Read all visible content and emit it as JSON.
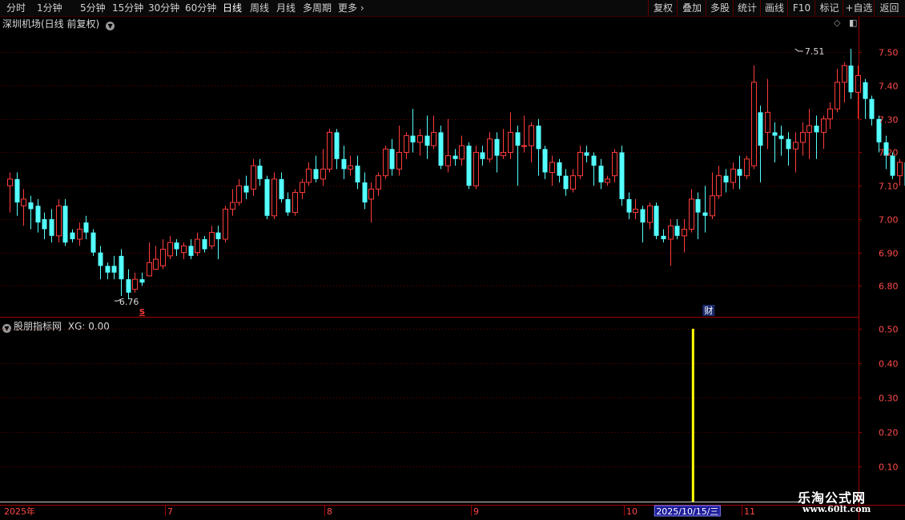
{
  "toolbar": {
    "periods": [
      "分时",
      "1分钟",
      "5分钟",
      "15分钟",
      "30分钟",
      "60分钟",
      "日线",
      "周线",
      "月线",
      "多周期",
      "更多"
    ],
    "active_period": "日线",
    "actions": [
      "复权",
      "叠加",
      "多股",
      "统计",
      "画线",
      "F10",
      "标记",
      "+自选",
      "返回"
    ]
  },
  "main_panel": {
    "title": "深圳机场(日线 前复权)",
    "high_label": "7.51",
    "low_label": "6.76",
    "marker_s": "S",
    "marker_cai": "财"
  },
  "sub_panel": {
    "title": "股朋指标网",
    "xg_label": "XG: 0.00"
  },
  "colors": {
    "up": "#ff3c3c",
    "down": "#54ffff",
    "signal": "#ffff00",
    "axis": "#a00000",
    "grid": "#6a0000"
  },
  "watermark": {
    "line1": "乐淘公式网",
    "line2": "www.60lt.com"
  },
  "chart_data": [
    {
      "type": "candlestick",
      "title": "深圳机场(日线 前复权)",
      "y_axis": {
        "ticks": [
          6.8,
          6.9,
          7.0,
          7.1,
          7.2,
          7.3,
          7.4,
          7.5
        ],
        "tick_labels": [
          "6.80",
          "6.90",
          "7.00",
          "7.10",
          "7.20",
          "7.30",
          "7.40",
          "7.50"
        ],
        "range": [
          6.71,
          7.57
        ]
      },
      "x_axis": {
        "month_labels": [
          "2025年",
          "7",
          "8",
          "9",
          "10",
          "11"
        ],
        "month_start_index": [
          0,
          23,
          46,
          67,
          89,
          106
        ],
        "highlighted_date": "2025/10/15/三",
        "highlighted_index": 99
      },
      "high": {
        "value": 7.51,
        "index": 113
      },
      "low": {
        "value": 6.76,
        "index": 16
      },
      "candles": [
        [
          7.1,
          7.12,
          7.14,
          7.02
        ],
        [
          7.12,
          7.05,
          7.14,
          7.01
        ],
        [
          7.04,
          7.06,
          7.09,
          6.98
        ],
        [
          7.05,
          7.03,
          7.07,
          6.97
        ],
        [
          7.04,
          6.99,
          7.06,
          6.96
        ],
        [
          7.0,
          6.97,
          7.02,
          6.94
        ],
        [
          7.0,
          6.95,
          7.03,
          6.93
        ],
        [
          6.95,
          7.04,
          7.06,
          6.93
        ],
        [
          7.04,
          6.93,
          7.06,
          6.92
        ],
        [
          6.96,
          6.94,
          6.97,
          6.93
        ],
        [
          6.94,
          6.97,
          6.99,
          6.92
        ],
        [
          6.99,
          6.96,
          7.01,
          6.94
        ],
        [
          6.96,
          6.9,
          6.97,
          6.89
        ],
        [
          6.9,
          6.86,
          6.92,
          6.82
        ],
        [
          6.86,
          6.84,
          6.87,
          6.82
        ],
        [
          6.86,
          6.84,
          6.89,
          6.82
        ],
        [
          6.89,
          6.82,
          6.91,
          6.77
        ],
        [
          6.82,
          6.78,
          6.85,
          6.76
        ],
        [
          6.79,
          6.82,
          6.84,
          6.78
        ],
        [
          6.82,
          6.81,
          6.84,
          6.8
        ],
        [
          6.83,
          6.87,
          6.93,
          6.83
        ],
        [
          6.85,
          6.88,
          6.92,
          6.85
        ],
        [
          6.86,
          6.91,
          6.94,
          6.85
        ],
        [
          6.89,
          6.93,
          6.95,
          6.88
        ],
        [
          6.93,
          6.91,
          6.94,
          6.89
        ],
        [
          6.9,
          6.92,
          6.93,
          6.88
        ],
        [
          6.92,
          6.89,
          6.94,
          6.88
        ],
        [
          6.9,
          6.94,
          6.96,
          6.89
        ],
        [
          6.94,
          6.91,
          6.95,
          6.9
        ],
        [
          6.92,
          6.96,
          6.98,
          6.91
        ],
        [
          6.96,
          6.94,
          6.98,
          6.88
        ],
        [
          6.94,
          7.03,
          7.04,
          6.93
        ],
        [
          7.03,
          7.05,
          7.09,
          7.01
        ],
        [
          7.05,
          7.1,
          7.12,
          7.04
        ],
        [
          7.1,
          7.08,
          7.13,
          7.06
        ],
        [
          7.09,
          7.16,
          7.18,
          7.07
        ],
        [
          7.16,
          7.12,
          7.18,
          7.1
        ],
        [
          7.12,
          7.01,
          7.13,
          7.0
        ],
        [
          7.01,
          7.12,
          7.14,
          7.0
        ],
        [
          7.12,
          7.06,
          7.14,
          7.05
        ],
        [
          7.06,
          7.02,
          7.08,
          7.01
        ],
        [
          7.02,
          7.08,
          7.09,
          7.01
        ],
        [
          7.08,
          7.11,
          7.12,
          7.06
        ],
        [
          7.11,
          7.15,
          7.17,
          7.1
        ],
        [
          7.15,
          7.12,
          7.19,
          7.11
        ],
        [
          7.12,
          7.15,
          7.21,
          7.1
        ],
        [
          7.15,
          7.26,
          7.27,
          7.14
        ],
        [
          7.26,
          7.18,
          7.27,
          7.15
        ],
        [
          7.18,
          7.15,
          7.22,
          7.12
        ],
        [
          7.15,
          7.16,
          7.19,
          7.13
        ],
        [
          7.16,
          7.11,
          7.19,
          7.09
        ],
        [
          7.11,
          7.05,
          7.14,
          7.03
        ],
        [
          7.06,
          7.09,
          7.11,
          6.99
        ],
        [
          7.09,
          7.13,
          7.14,
          7.07
        ],
        [
          7.13,
          7.21,
          7.22,
          7.12
        ],
        [
          7.21,
          7.15,
          7.24,
          7.13
        ],
        [
          7.15,
          7.2,
          7.28,
          7.13
        ],
        [
          7.2,
          7.25,
          7.26,
          7.18
        ],
        [
          7.25,
          7.23,
          7.33,
          7.2
        ],
        [
          7.23,
          7.25,
          7.27,
          7.19
        ],
        [
          7.25,
          7.22,
          7.31,
          7.18
        ],
        [
          7.22,
          7.26,
          7.31,
          7.21
        ],
        [
          7.26,
          7.16,
          7.28,
          7.15
        ],
        [
          7.16,
          7.19,
          7.3,
          7.14
        ],
        [
          7.19,
          7.18,
          7.21,
          7.16
        ],
        [
          7.18,
          7.22,
          7.25,
          7.16
        ],
        [
          7.22,
          7.1,
          7.23,
          7.09
        ],
        [
          7.1,
          7.2,
          7.22,
          7.09
        ],
        [
          7.2,
          7.18,
          7.22,
          7.16
        ],
        [
          7.18,
          7.24,
          7.26,
          7.17
        ],
        [
          7.24,
          7.19,
          7.26,
          7.14
        ],
        [
          7.19,
          7.2,
          7.27,
          7.18
        ],
        [
          7.2,
          7.26,
          7.32,
          7.18
        ],
        [
          7.26,
          7.22,
          7.28,
          7.1
        ],
        [
          7.22,
          7.22,
          7.31,
          7.2
        ],
        [
          7.22,
          7.28,
          7.29,
          7.17
        ],
        [
          7.28,
          7.21,
          7.3,
          7.13
        ],
        [
          7.21,
          7.14,
          7.22,
          7.12
        ],
        [
          7.14,
          7.17,
          7.19,
          7.1
        ],
        [
          7.17,
          7.13,
          7.18,
          7.11
        ],
        [
          7.13,
          7.09,
          7.15,
          7.07
        ],
        [
          7.09,
          7.13,
          7.15,
          7.08
        ],
        [
          7.13,
          7.2,
          7.22,
          7.12
        ],
        [
          7.2,
          7.19,
          7.22,
          7.17
        ],
        [
          7.19,
          7.16,
          7.2,
          7.1
        ],
        [
          7.16,
          7.11,
          7.18,
          7.09
        ],
        [
          7.11,
          7.12,
          7.13,
          7.1
        ],
        [
          7.13,
          7.2,
          7.21,
          7.11
        ],
        [
          7.2,
          7.06,
          7.22,
          7.04
        ],
        [
          7.06,
          7.02,
          7.08,
          7.0
        ],
        [
          7.02,
          7.03,
          7.06,
          7.0
        ],
        [
          7.03,
          6.99,
          7.04,
          6.93
        ],
        [
          6.99,
          7.04,
          7.05,
          6.97
        ],
        [
          7.04,
          6.95,
          7.05,
          6.94
        ],
        [
          6.95,
          6.94,
          6.97,
          6.93
        ],
        [
          6.94,
          6.98,
          7.0,
          6.86
        ],
        [
          6.98,
          6.95,
          7.0,
          6.94
        ],
        [
          6.95,
          6.97,
          7.0,
          6.9
        ],
        [
          6.97,
          7.06,
          7.09,
          6.96
        ],
        [
          7.06,
          7.02,
          7.08,
          6.94
        ],
        [
          7.02,
          7.01,
          7.1,
          6.96
        ],
        [
          7.01,
          7.07,
          7.14,
          7.0
        ],
        [
          7.07,
          7.13,
          7.16,
          7.06
        ],
        [
          7.13,
          7.11,
          7.15,
          7.08
        ],
        [
          7.11,
          7.15,
          7.17,
          7.09
        ],
        [
          7.15,
          7.13,
          7.19,
          7.09
        ],
        [
          7.13,
          7.18,
          7.19,
          7.12
        ],
        [
          7.16,
          7.41,
          7.46,
          7.15
        ],
        [
          7.32,
          7.22,
          7.34,
          7.11
        ],
        [
          7.26,
          7.32,
          7.42,
          7.21
        ],
        [
          7.26,
          7.25,
          7.29,
          7.17
        ],
        [
          7.25,
          7.24,
          7.28,
          7.19
        ],
        [
          7.24,
          7.21,
          7.26,
          7.16
        ],
        [
          7.21,
          7.23,
          7.26,
          7.14
        ],
        [
          7.23,
          7.26,
          7.29,
          7.19
        ],
        [
          7.26,
          7.28,
          7.33,
          7.18
        ],
        [
          7.28,
          7.26,
          7.31,
          7.18
        ],
        [
          7.26,
          7.3,
          7.31,
          7.21
        ],
        [
          7.3,
          7.33,
          7.35,
          7.27
        ],
        [
          7.33,
          7.41,
          7.45,
          7.32
        ],
        [
          7.41,
          7.46,
          7.47,
          7.35
        ],
        [
          7.46,
          7.38,
          7.51,
          7.36
        ],
        [
          7.38,
          7.43,
          7.46,
          7.3
        ],
        [
          7.41,
          7.36,
          7.42,
          7.3
        ],
        [
          7.36,
          7.3,
          7.37,
          7.28
        ],
        [
          7.3,
          7.23,
          7.31,
          7.2
        ],
        [
          7.23,
          7.19,
          7.25,
          7.15
        ],
        [
          7.19,
          7.13,
          7.2,
          7.12
        ],
        [
          7.13,
          7.17,
          7.18,
          7.1
        ],
        [
          7.17,
          7.1,
          7.19,
          7.09
        ],
        [
          7.1,
          6.95,
          7.12,
          6.94
        ],
        [
          6.95,
          6.99,
          7.0,
          6.92
        ],
        [
          6.99,
          6.93,
          7.01,
          6.91
        ],
        [
          6.93,
          6.95,
          6.97,
          6.9
        ],
        [
          6.95,
          6.91,
          6.96,
          6.9
        ],
        [
          6.91,
          6.92,
          6.93,
          6.89
        ],
        [
          6.92,
          6.96,
          6.97,
          6.88
        ],
        [
          6.96,
          6.95,
          6.97,
          6.93
        ],
        [
          6.95,
          6.98,
          6.99,
          6.94
        ],
        [
          6.98,
          7.02,
          7.04,
          6.97
        ],
        [
          7.02,
          7.02,
          7.02,
          6.97
        ],
        [
          7.02,
          6.97,
          7.02,
          6.95
        ]
      ]
    },
    {
      "type": "bar",
      "title": "股朋指标网",
      "series": [
        {
          "name": "XG",
          "values_by_index": {
            "99": 0.5
          }
        }
      ],
      "y_axis": {
        "ticks": [
          0.1,
          0.2,
          0.3,
          0.4,
          0.5
        ],
        "tick_labels": [
          "0.10",
          "0.20",
          "0.30",
          "0.40",
          "0.50"
        ],
        "range": [
          0,
          0.53
        ]
      }
    }
  ]
}
